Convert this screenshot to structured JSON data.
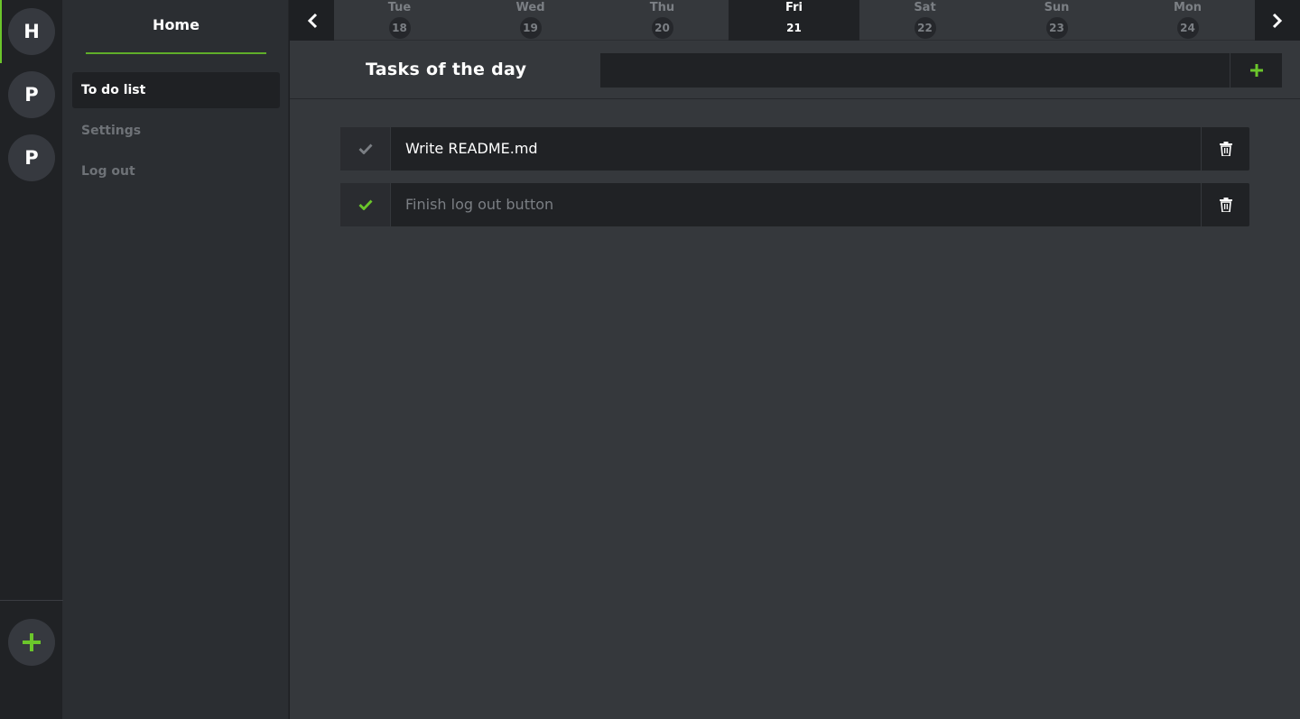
{
  "rail": {
    "servers": [
      {
        "letter": "H"
      },
      {
        "letter": "P"
      },
      {
        "letter": "P"
      }
    ],
    "accent": "#6bc62b"
  },
  "sidebar": {
    "title": "Home",
    "items": [
      {
        "label": "To do list",
        "active": true
      },
      {
        "label": "Settings",
        "active": false
      },
      {
        "label": "Log out",
        "active": false
      }
    ]
  },
  "daybar": {
    "days": [
      {
        "name": "Tue",
        "num": "18"
      },
      {
        "name": "Wed",
        "num": "19"
      },
      {
        "name": "Thu",
        "num": "20"
      },
      {
        "name": "Fri",
        "num": "21",
        "active": true
      },
      {
        "name": "Sat",
        "num": "22"
      },
      {
        "name": "Sun",
        "num": "23"
      },
      {
        "name": "Mon",
        "num": "24"
      }
    ]
  },
  "tasks": {
    "title": "Tasks of the day",
    "input_value": "",
    "items": [
      {
        "text": "Write README.md",
        "done": false
      },
      {
        "text": "Finish log out button",
        "done": true
      }
    ]
  },
  "colors": {
    "accent": "#6bc62b",
    "check_pending": "#7b7f84",
    "check_done": "#6bc62b"
  }
}
